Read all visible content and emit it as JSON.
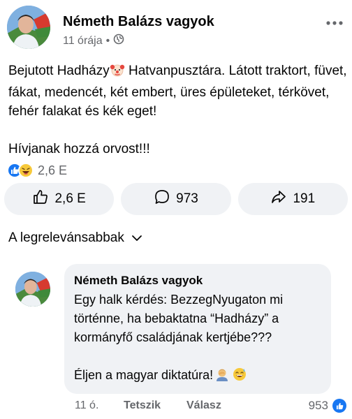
{
  "post": {
    "author": "Németh Balázs vagyok",
    "time": "11 órája",
    "separator": "•",
    "text_part1": "Bejutott Hadházy",
    "text_part2": " Hatvanpusztára. Látott traktort, füvet, fákat, medencét, két embert, üres épületeket, térkövet, fehér falakat és kék eget!",
    "text_line2": "Hívjanak hozzá orvost!!!",
    "reaction_count": "2,6 E",
    "icons": {
      "more": "more-options-icon",
      "privacy": "globe-icon",
      "clown": "clown-emoji",
      "like": "like-reaction-icon",
      "haha": "haha-reaction-icon"
    }
  },
  "actions": {
    "like_count": "2,6 E",
    "comment_count": "973",
    "share_count": "191"
  },
  "sort": {
    "label": "A legrelevánsabbak"
  },
  "comment": {
    "author": "Németh Balázs vagyok",
    "text_part1": "Egy halk kérdés: BezzegNyugaton mi történne, ha bebaktatna “Hadházy” a kormányfő családjának kertjébe???",
    "text_part2": "Éljen a magyar diktatúra!",
    "time": "11 ó.",
    "like_label": "Tetszik",
    "reply_label": "Válasz",
    "like_count": "953"
  },
  "colors": {
    "facebook_blue": "#1877f2",
    "secondary_text": "#65676b",
    "surface_gray": "#f0f2f5"
  }
}
